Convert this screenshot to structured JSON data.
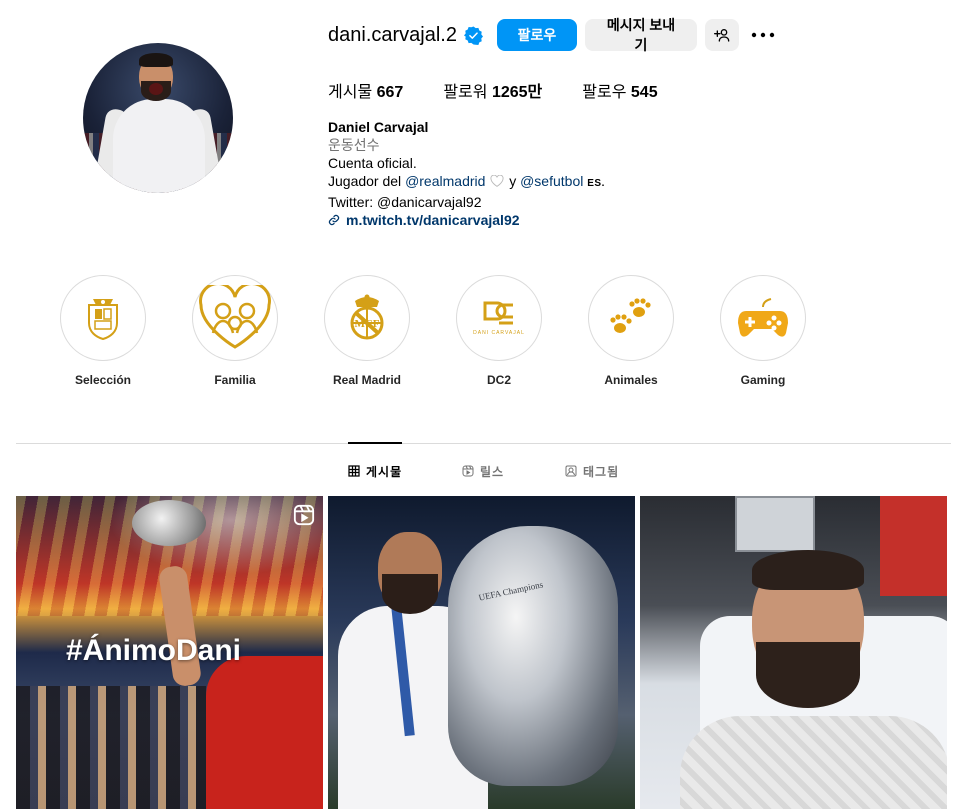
{
  "profile": {
    "username": "dani.carvajal.2",
    "verified": true,
    "follow_label": "팔로우",
    "message_label": "메시지 보내기",
    "stats": {
      "posts_label": "게시물",
      "posts_value": "667",
      "followers_label": "팔로워",
      "followers_value": "1265만",
      "following_label": "팔로우",
      "following_value": "545"
    },
    "bio": {
      "name": "Daniel Carvajal",
      "category": "운동선수",
      "line1": "Cuenta oficial.",
      "line2_prefix": "Jugador del",
      "mention1": "@realmadrid",
      "line2_mid": "y",
      "mention2": "@sefutbol",
      "line2_suffix": "ES.",
      "line3": "Twitter: @danicarvajal92",
      "link": "m.twitch.tv/danicarvajal92"
    }
  },
  "highlights": [
    {
      "label": "Selección"
    },
    {
      "label": "Familia"
    },
    {
      "label": "Real Madrid"
    },
    {
      "label": "DC2",
      "logo_text": "DANI CARVAJAL"
    },
    {
      "label": "Animales"
    },
    {
      "label": "Gaming"
    }
  ],
  "tabs": [
    {
      "label": "게시물",
      "icon": "grid-icon",
      "active": true
    },
    {
      "label": "릴스",
      "icon": "reels-icon",
      "active": false
    },
    {
      "label": "태그됨",
      "icon": "tagged-icon",
      "active": false
    }
  ],
  "posts": [
    {
      "overlay_text": "#ÁnimoDani",
      "icon": "reels-icon"
    },
    {
      "trophy_text": "UEFA Champions"
    },
    {}
  ],
  "colors": {
    "accent": "#0095f6",
    "gold": "#d4a017",
    "link": "#00376b",
    "muted": "#737373"
  }
}
